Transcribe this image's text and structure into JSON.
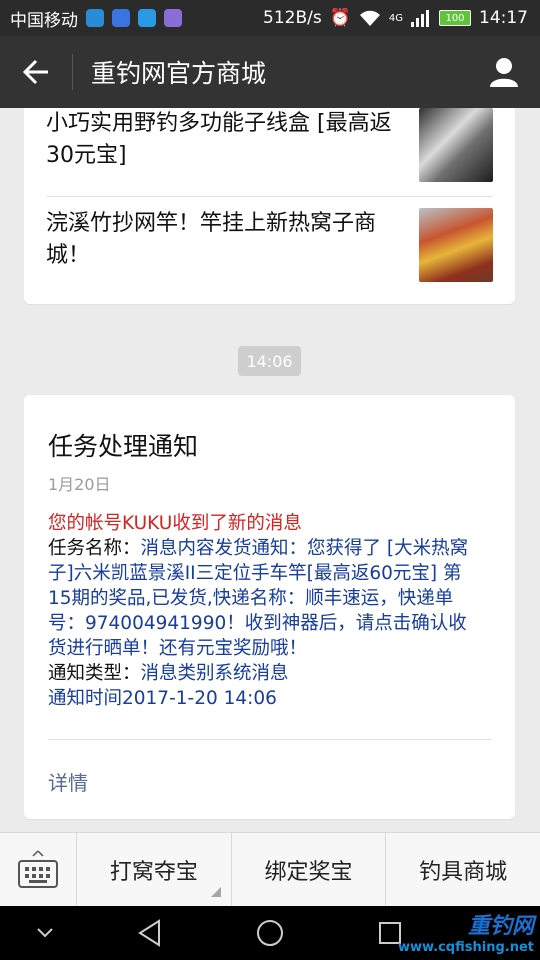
{
  "status": {
    "carrier": "中国移动",
    "speed": "512B/s",
    "network": "4G",
    "battery": "100",
    "time": "14:17"
  },
  "titlebar": {
    "title": "重钓网官方商城",
    "back_icon": "back-arrow-icon",
    "user_icon": "user-icon"
  },
  "news": [
    {
      "title": "小巧实用野钓多功能子线盒 [最高返30元宝]"
    },
    {
      "title": "浣溪竹抄网竿！竿挂上新热窝子商城！"
    }
  ],
  "message": {
    "time": "14:06",
    "title": "任务处理通知",
    "date": "1月20日",
    "headline": "您的帐号KUKU收到了新的消息",
    "task_label": "任务名称：",
    "task_value": "消息内容发货通知：您获得了 [大米热窝子]六米凯蓝景溪II三定位手车竿[最高返60元宝] 第15期的奖品,已发货,快递名称：顺丰速运，快递单号：974004941990！收到神器后，请点击确认收货进行晒单！还有元宝奖励哦！",
    "type_label": "通知类型：",
    "type_value": "消息类别系统消息",
    "notify_time": "通知时间2017-1-20 14:06",
    "detail_link": "详情"
  },
  "menu": {
    "keyboard_icon": "keyboard-icon",
    "items": [
      "打窝夺宝",
      "绑定奖宝",
      "钓具商城"
    ]
  },
  "watermark": {
    "name": "重钓网",
    "url": "www.cqfishing.net"
  },
  "colors": {
    "header_bg": "#333333",
    "headline_red": "#d42323",
    "value_blue": "#173da0",
    "link_blue": "#576b95"
  }
}
